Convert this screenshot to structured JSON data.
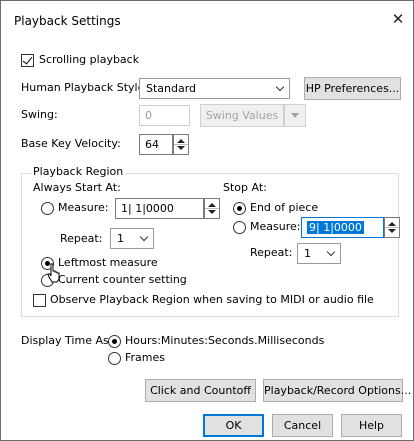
{
  "window": {
    "title": "Playback Settings",
    "close_glyph": "✕"
  },
  "scrolling_playback": {
    "label": "Scrolling playback",
    "checked": true
  },
  "human_playback": {
    "label": "Human Playback Style:",
    "value": "Standard",
    "button": "HP Preferences..."
  },
  "swing": {
    "label": "Swing:",
    "value": "0",
    "button": "Swing Values"
  },
  "base_key_velocity": {
    "label": "Base Key Velocity:",
    "value": "64"
  },
  "playback_region": {
    "label": "Playback Region",
    "always_start_at": {
      "label": "Always Start At:",
      "measure_label": "Measure:",
      "measure_value": "1| 1|0000",
      "repeat_label": "Repeat:",
      "repeat_value": "1",
      "leftmost_label": "Leftmost measure",
      "current_counter_label": "Current counter setting",
      "selected": "leftmost"
    },
    "stop_at": {
      "label": "Stop At:",
      "end_label": "End of piece",
      "measure_label": "Measure:",
      "measure_value": "9| 1|0000",
      "repeat_label": "Repeat:",
      "repeat_value": "1",
      "selected": "end"
    },
    "observe": {
      "label": "Observe Playback Region when saving to MIDI or audio file",
      "checked": false
    }
  },
  "display_time": {
    "label": "Display Time As:",
    "options": [
      "Hours:Minutes:Seconds.Milliseconds",
      "Frames"
    ],
    "selected": "Hours:Minutes:Seconds.Milliseconds"
  },
  "buttons": {
    "click_countoff": "Click and Countoff",
    "playback_record": "Playback/Record Options...",
    "ok": "OK",
    "cancel": "Cancel",
    "help": "Help"
  },
  "colors": {
    "accent": "#0078d7",
    "selection": "#0078d7"
  }
}
